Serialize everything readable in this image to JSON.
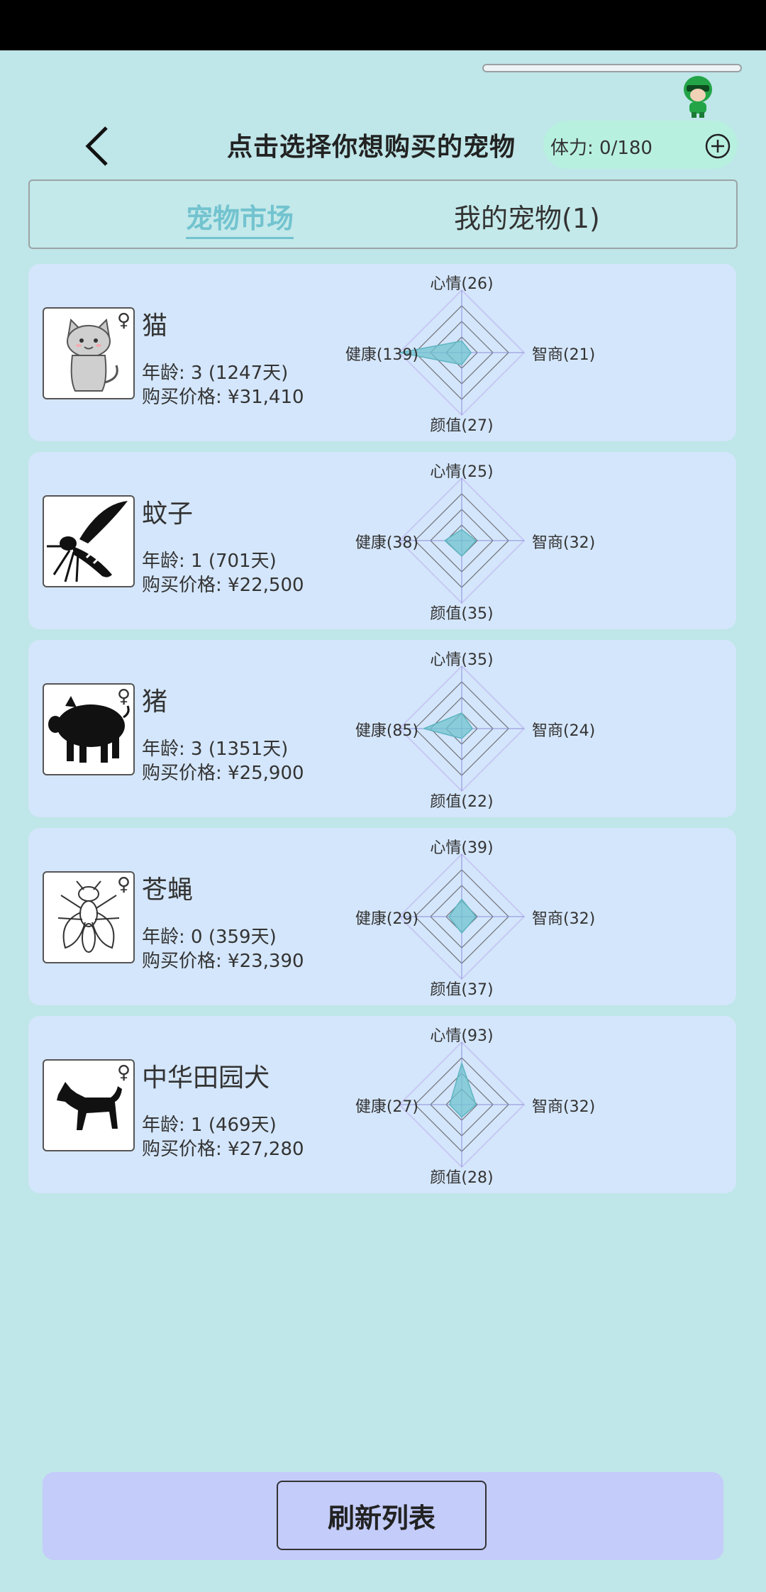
{
  "header": {
    "title": "点击选择你想购买的宠物",
    "stamina": "体力: 0/180"
  },
  "tabs": {
    "market": "宠物市场",
    "mine": "我的宠物(1)"
  },
  "pets": [
    {
      "name": "猫",
      "icon": "cat-icon",
      "gender": "♀",
      "age": "年龄: 3 (1247天)",
      "price": "购买价格: ¥31,410",
      "mood_label": "心情(26)",
      "iq_label": "智商(21)",
      "looks_label": "颜值(27)",
      "health_label": "健康(139)",
      "stats": {
        "mood": 26,
        "iq": 21,
        "looks": 27,
        "health": 139
      }
    },
    {
      "name": "蚊子",
      "icon": "mosquito-icon",
      "gender": "",
      "age": "年龄: 1 (701天)",
      "price": "购买价格: ¥22,500",
      "mood_label": "心情(25)",
      "iq_label": "智商(32)",
      "looks_label": "颜值(35)",
      "health_label": "健康(38)",
      "stats": {
        "mood": 25,
        "iq": 32,
        "looks": 35,
        "health": 38
      }
    },
    {
      "name": "猪",
      "icon": "pig-icon",
      "gender": "♀",
      "age": "年龄: 3 (1351天)",
      "price": "购买价格: ¥25,900",
      "mood_label": "心情(35)",
      "iq_label": "智商(24)",
      "looks_label": "颜值(22)",
      "health_label": "健康(85)",
      "stats": {
        "mood": 35,
        "iq": 24,
        "looks": 22,
        "health": 85
      }
    },
    {
      "name": "苍蝇",
      "icon": "fly-icon",
      "gender": "♀",
      "age": "年龄: 0 (359天)",
      "price": "购买价格: ¥23,390",
      "mood_label": "心情(39)",
      "iq_label": "智商(32)",
      "looks_label": "颜值(37)",
      "health_label": "健康(29)",
      "stats": {
        "mood": 39,
        "iq": 32,
        "looks": 37,
        "health": 29
      }
    },
    {
      "name": "中华田园犬",
      "icon": "dog-icon",
      "gender": "♀",
      "age": "年龄: 1 (469天)",
      "price": "购买价格: ¥27,280",
      "mood_label": "心情(93)",
      "iq_label": "智商(32)",
      "looks_label": "颜值(28)",
      "health_label": "健康(27)",
      "stats": {
        "mood": 93,
        "iq": 32,
        "looks": 28,
        "health": 27
      }
    }
  ],
  "radar_max": 140,
  "footer": {
    "refresh": "刷新列表"
  },
  "colors": {
    "background": "#bfe6e8",
    "card": "#d4e6fb",
    "accent": "#72c3cf",
    "stamina_pill": "#b8f0e0",
    "footer_bar": "#c4ccfa"
  }
}
